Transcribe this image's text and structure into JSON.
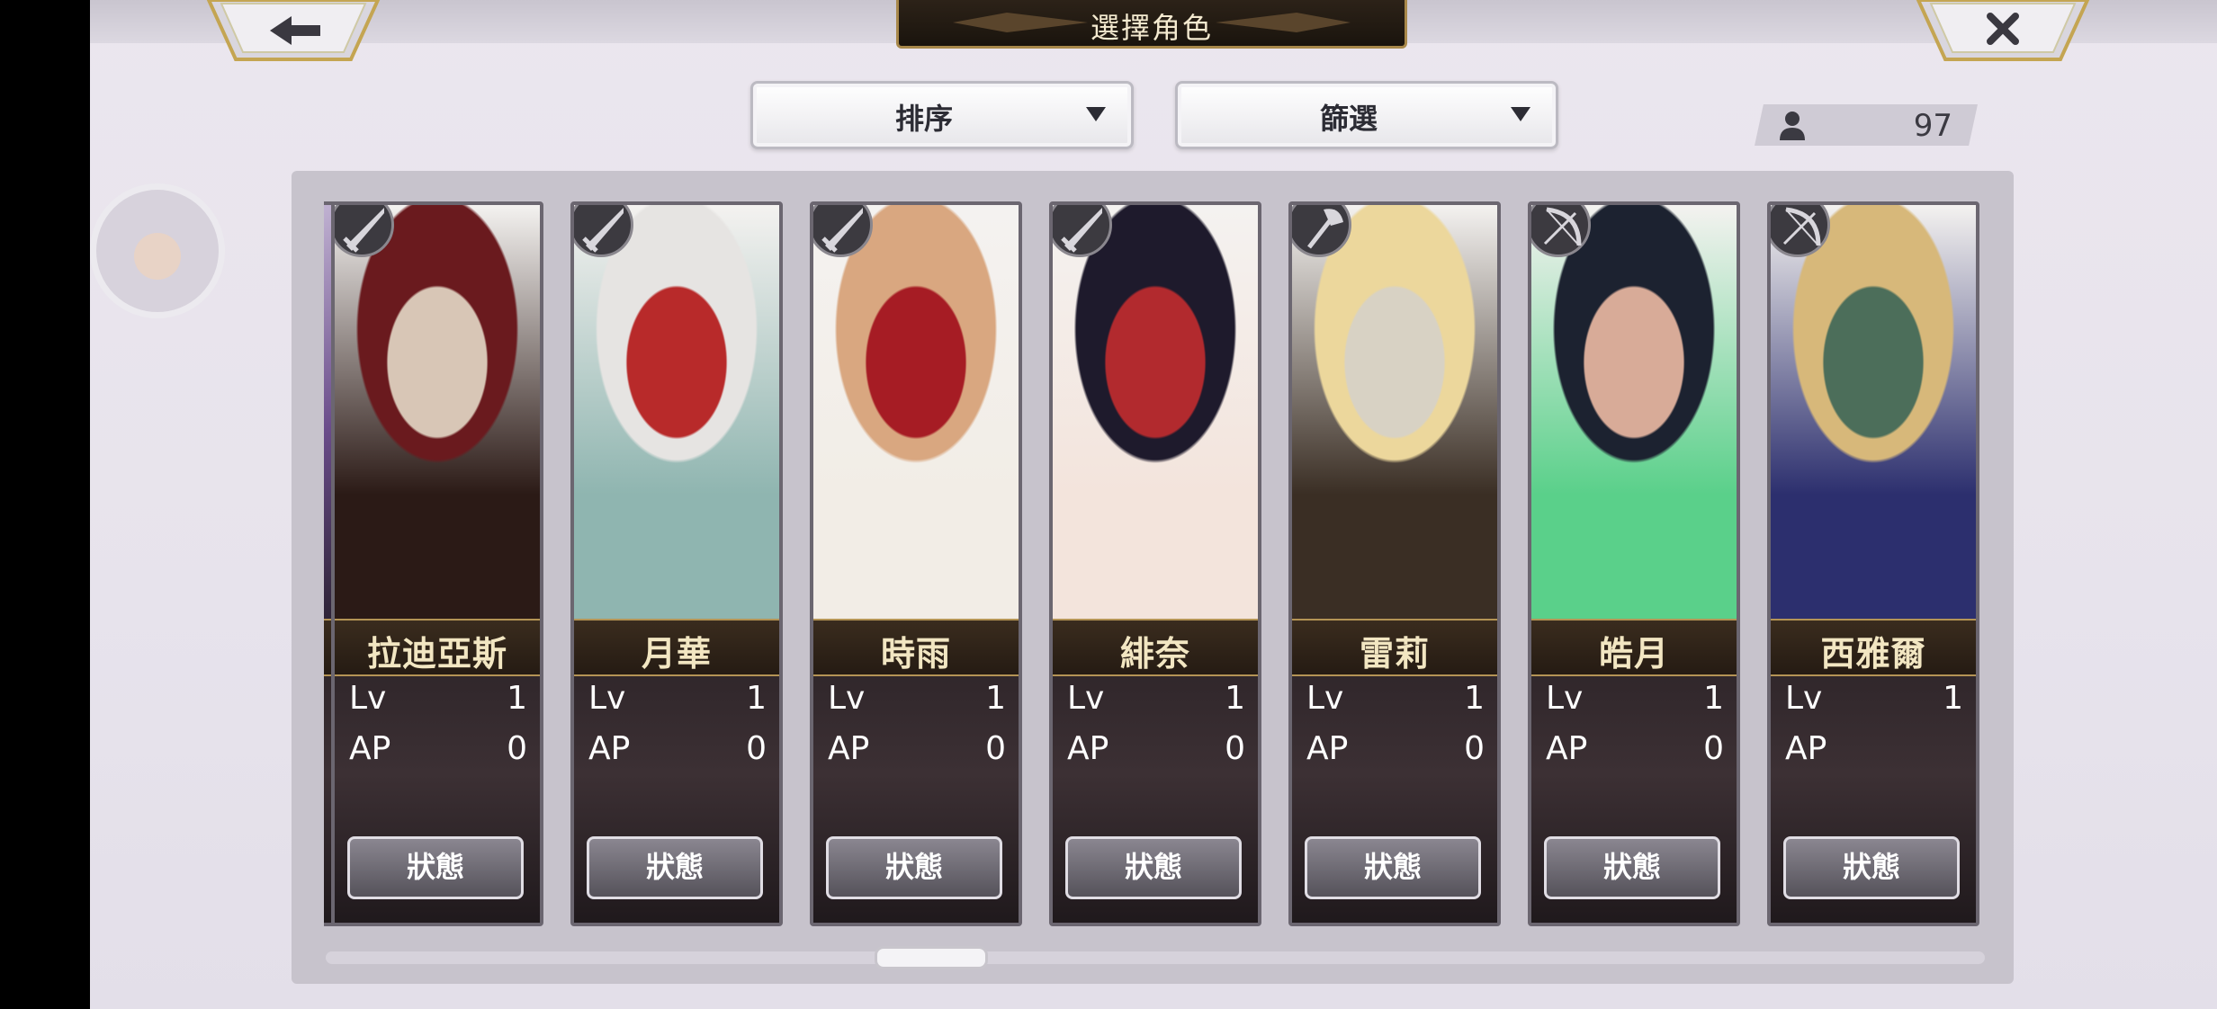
{
  "header": {
    "title": "選擇角色",
    "back_icon": "arrow-left-icon",
    "close_icon": "close-icon"
  },
  "toolbar": {
    "sort_label": "排序",
    "filter_label": "篩選",
    "character_count": "97"
  },
  "characters": [
    {
      "name": "拉迪亞斯",
      "lv_label": "Lv",
      "lv": "1",
      "ap_label": "AP",
      "ap": "0",
      "status_label": "狀態",
      "weapon": "sword-icon",
      "palette": [
        "#6a1a1e",
        "#2b1a16",
        "#d8c6b6"
      ]
    },
    {
      "name": "月華",
      "lv_label": "Lv",
      "lv": "1",
      "ap_label": "AP",
      "ap": "0",
      "status_label": "狀態",
      "weapon": "sword-icon",
      "palette": [
        "#e6e4e2",
        "#8fb5b0",
        "#b82a2a"
      ]
    },
    {
      "name": "時雨",
      "lv_label": "Lv",
      "lv": "1",
      "ap_label": "AP",
      "ap": "0",
      "status_label": "狀態",
      "weapon": "sword-icon",
      "palette": [
        "#d9a780",
        "#f2ede6",
        "#a61c24"
      ]
    },
    {
      "name": "緋奈",
      "lv_label": "Lv",
      "lv": "1",
      "ap_label": "AP",
      "ap": "0",
      "status_label": "狀態",
      "weapon": "sword-icon",
      "palette": [
        "#1e1a2c",
        "#f3e4dc",
        "#b22a2e"
      ]
    },
    {
      "name": "雷莉",
      "lv_label": "Lv",
      "lv": "1",
      "ap_label": "AP",
      "ap": "0",
      "status_label": "狀態",
      "weapon": "axe-icon",
      "palette": [
        "#ecd79c",
        "#3a2e24",
        "#d8d2c4"
      ]
    },
    {
      "name": "皓月",
      "lv_label": "Lv",
      "lv": "1",
      "ap_label": "AP",
      "ap": "0",
      "status_label": "狀態",
      "weapon": "bow-icon",
      "palette": [
        "#1c2230",
        "#5ad08a",
        "#d8ab98"
      ]
    },
    {
      "name": "西雅爾",
      "lv_label": "Lv",
      "lv": "1",
      "ap_label": "AP",
      "ap": "",
      "status_label": "狀態",
      "weapon": "bow-icon",
      "palette": [
        "#d7b87a",
        "#2c2f6e",
        "#4c6e5a"
      ]
    }
  ]
}
